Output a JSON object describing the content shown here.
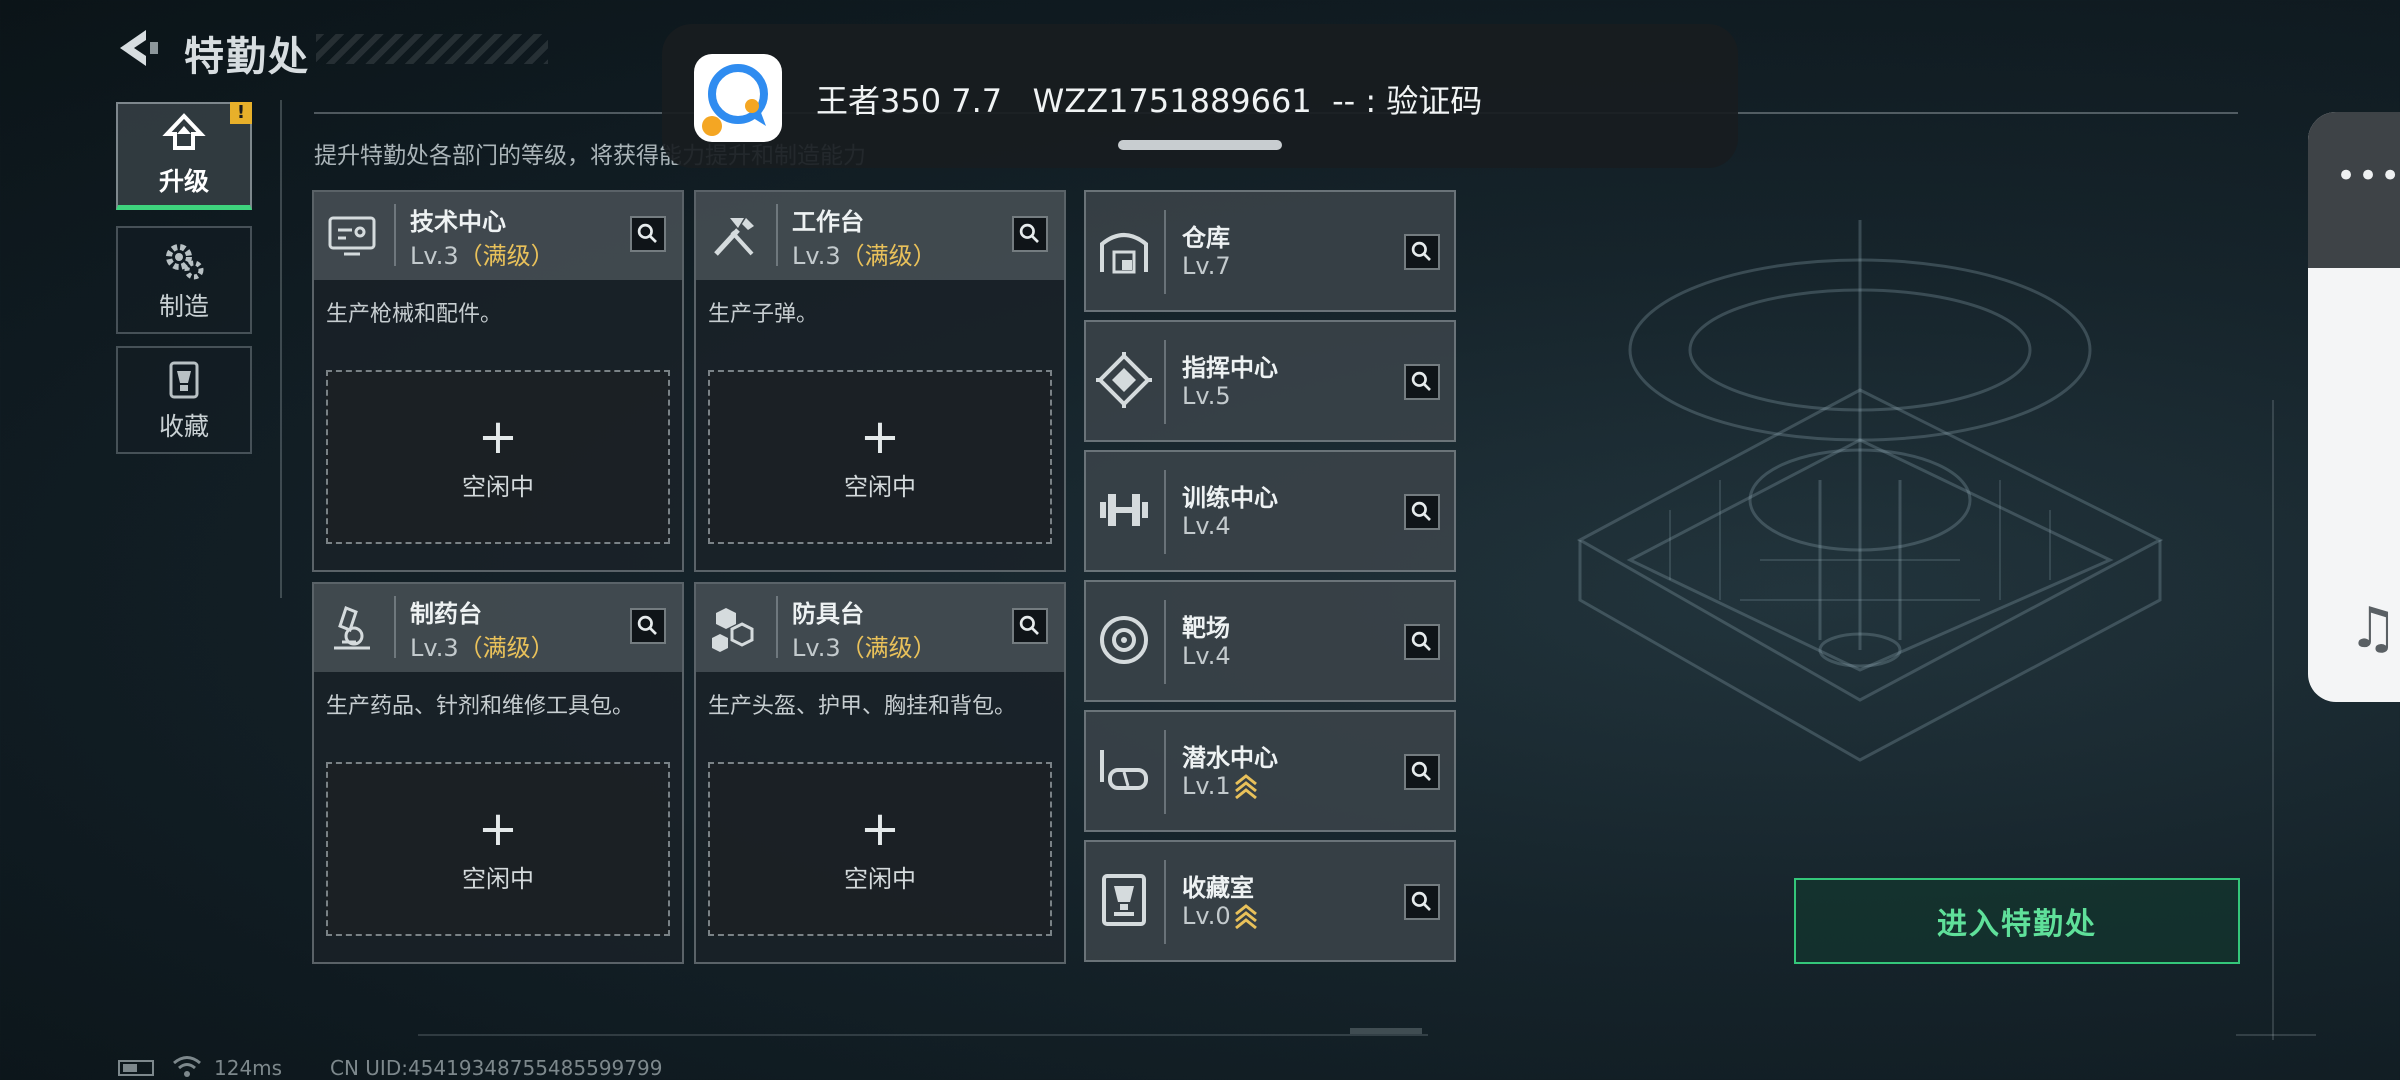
{
  "header": {
    "title": "特勤处",
    "subtitle": "提升特勤处各部门的等级，将获得能力提升和制造能力"
  },
  "nav": {
    "items": [
      {
        "label": "升级",
        "icon": "upgrade-arrow-icon",
        "active": true,
        "badge": "!"
      },
      {
        "label": "制造",
        "icon": "gears-icon",
        "active": false
      },
      {
        "label": "收藏",
        "icon": "collection-icon",
        "active": false
      }
    ]
  },
  "departments": [
    {
      "name": "技术中心",
      "level": "Lv.3",
      "level_note": "（满级）",
      "desc": "生产枪械和配件。",
      "slot_label": "空闲中",
      "icon": "computer-icon"
    },
    {
      "name": "工作台",
      "level": "Lv.3",
      "level_note": "（满级）",
      "desc": "生产子弹。",
      "slot_label": "空闲中",
      "icon": "tools-icon"
    },
    {
      "name": "制药台",
      "level": "Lv.3",
      "level_note": "（满级）",
      "desc": "生产药品、针剂和维修工具包。",
      "slot_label": "空闲中",
      "icon": "microscope-icon"
    },
    {
      "name": "防具台",
      "level": "Lv.3",
      "level_note": "（满级）",
      "desc": "生产头盔、护甲、胸挂和背包。",
      "slot_label": "空闲中",
      "icon": "armor-blocks-icon"
    }
  ],
  "facilities": [
    {
      "name": "仓库",
      "level": "Lv.7",
      "icon": "warehouse-icon",
      "upgradable": false
    },
    {
      "name": "指挥中心",
      "level": "Lv.5",
      "icon": "command-center-icon",
      "upgradable": false
    },
    {
      "name": "训练中心",
      "level": "Lv.4",
      "icon": "dumbbell-icon",
      "upgradable": false
    },
    {
      "name": "靶场",
      "level": "Lv.4",
      "icon": "target-icon",
      "upgradable": false
    },
    {
      "name": "潜水中心",
      "level": "Lv.1",
      "icon": "diving-mask-icon",
      "upgradable": true
    },
    {
      "name": "收藏室",
      "level": "Lv.0",
      "icon": "trophy-icon",
      "upgradable": true
    }
  ],
  "enter_button": "进入特勤处",
  "notification": {
    "text": "王者350 7.7   WZZ1751889661  -- : 验证码",
    "app_icon": "chat-bubble-app-icon"
  },
  "status": {
    "ping": "124ms",
    "uid": "CN UID:454193487554855997​99"
  },
  "colors": {
    "accent_green": "#3ed37d",
    "max_level_gold": "#e9c15a",
    "badge_yellow": "#e8b02a"
  }
}
